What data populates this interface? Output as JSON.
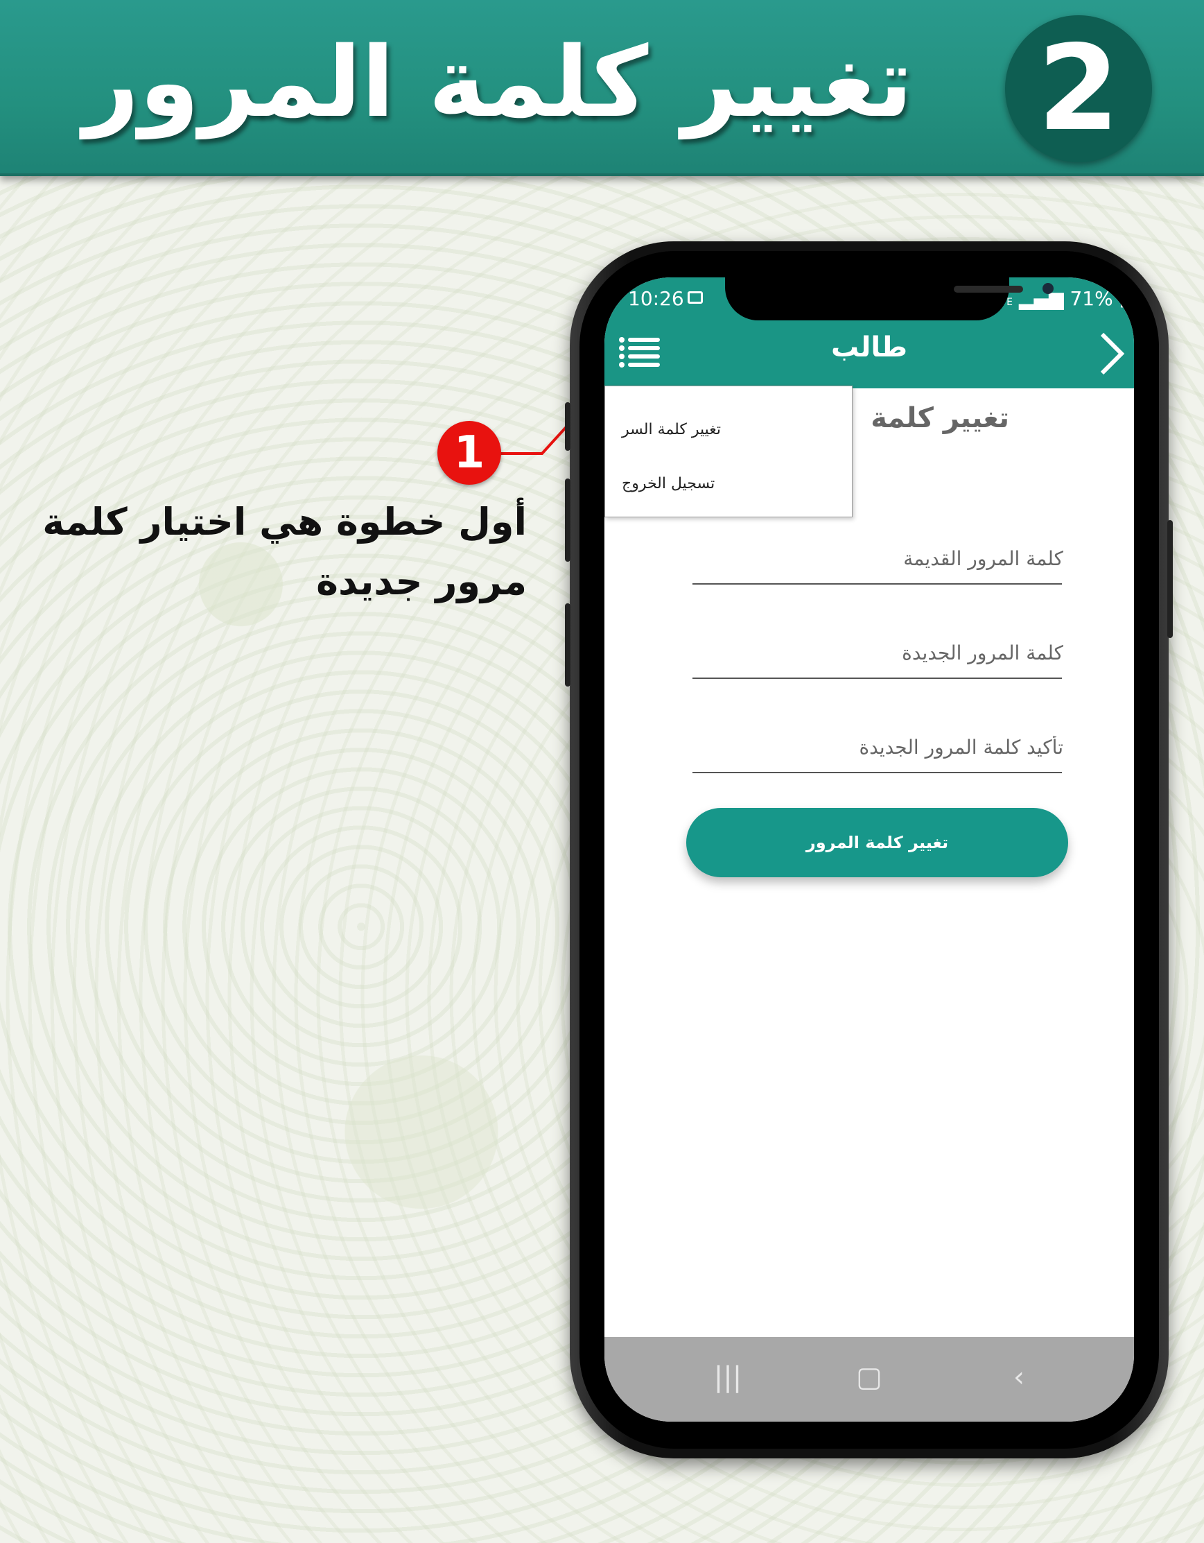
{
  "banner": {
    "title": "تغيير كلمة المرور",
    "step_number": "2"
  },
  "callout": {
    "number": "1",
    "text": "أول خطوة هي اختيار كلمة مرور جديدة"
  },
  "phone": {
    "status": {
      "time": "10:26",
      "network": "LTE",
      "battery": "71%"
    },
    "app_bar": {
      "title": "طالب"
    },
    "menu": {
      "items": [
        {
          "label": "تغيير كلمة السر"
        },
        {
          "label": "تسجيل الخروج"
        }
      ]
    },
    "page_heading": "تغيير كلمة",
    "form": {
      "old_password_placeholder": "كلمة المرور القديمة",
      "new_password_placeholder": "كلمة المرور الجديدة",
      "confirm_password_placeholder": "تأكيد كلمة المرور الجديدة",
      "submit_label": "تغيير كلمة المرور"
    }
  },
  "colors": {
    "accent": "#1a9585",
    "banner": "#23907f",
    "callout": "#e8120f"
  }
}
